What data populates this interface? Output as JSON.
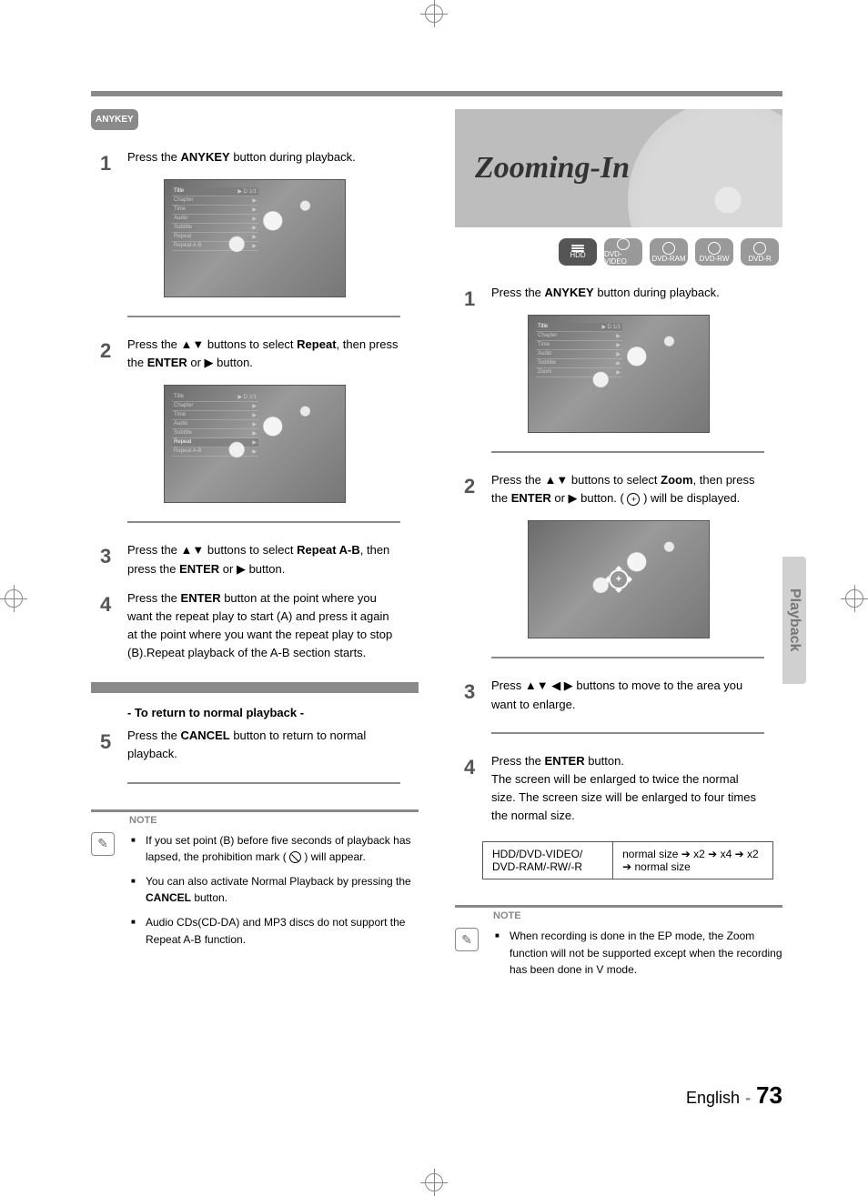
{
  "left": {
    "badge": "ANYKEY",
    "step1": {
      "num": "1",
      "pre": "Press the ",
      "btn": "ANYKEY",
      "post": " button during playback."
    },
    "step2": {
      "num": "2",
      "pre": "Press the ",
      "nav": "▲▼",
      "mid": " buttons to select ",
      "sel": "Repeat",
      "mid2": ", then press the ",
      "btn": "ENTER",
      "or": " or ",
      "arrow": "▶",
      "post": " button."
    },
    "step3": {
      "num": "3",
      "pre": "Press the ",
      "nav": "▲▼",
      "mid": " buttons to select ",
      "sel": "Repeat A-B",
      "mid2": ", then press the ",
      "btn": "ENTER",
      "or": " or ",
      "arrow": "▶",
      "post": " button."
    },
    "step4": {
      "num": "4",
      "pre": "Press the ",
      "btn": "ENTER",
      "post": " button at the point where you want the repeat play to start (A) and press it again at the point where you want the repeat play to stop (B).Repeat playback of the A-B section starts."
    },
    "cancel_heading": "- To return to normal playback -",
    "step5": {
      "num": "5",
      "pre": "Press the ",
      "btn": "CANCEL",
      "post": " button to return to normal playback."
    },
    "note_tag": "NOTE",
    "notes": [
      {
        "pre": "If you set point (B) before five seconds of playback has lapsed, the prohibition mark ( ",
        "post": " ) will appear."
      },
      {
        "pre": "You can also activate Normal Playback by pressing the ",
        "btn": "CANCEL",
        "post": " button."
      },
      {
        "txt": "Audio CDs(CD-DA) and MP3 discs do not support the Repeat A-B function."
      }
    ],
    "menu": {
      "rows": [
        {
          "l": "Title",
          "r": "D 1/1"
        },
        {
          "l": "Chapter",
          "r": ""
        },
        {
          "l": "Time",
          "r": ""
        },
        {
          "l": "Audio",
          "r": ""
        },
        {
          "l": "Subtitle",
          "r": ""
        },
        {
          "l": "Repeat",
          "r": ""
        },
        {
          "l": "Repeat A-B",
          "r": ""
        }
      ]
    }
  },
  "right": {
    "title": "Zooming-In",
    "media": [
      "HDD",
      "DVD-VIDEO",
      "DVD-RAM",
      "DVD-RW",
      "DVD-R"
    ],
    "step1": {
      "num": "1",
      "pre": "Press the ",
      "btn": "ANYKEY",
      "post": " button during playback."
    },
    "step2": {
      "num": "2",
      "pre": "Press the ",
      "nav": "▲▼",
      "mid": " buttons to select ",
      "sel": "Zoom",
      "mid2": ", then press the ",
      "btn": "ENTER",
      "or": " or ",
      "arrow": "▶",
      "post": " button. ( ",
      "post2": " ) will be displayed."
    },
    "step3": {
      "num": "3",
      "pre": "Press ",
      "nav": "▲▼ ◀ ▶",
      "post": " buttons to move to the area you want to enlarge."
    },
    "step4": {
      "num": "4",
      "pre": "Press the ",
      "btn": "ENTER",
      "post": " button.",
      "line2": "The screen will be enlarged to twice the normal size. The screen size will be enlarged to four times the normal size."
    },
    "zoom_table": {
      "c1": "HDD/DVD-VIDEO/\nDVD-RAM/-RW/-R",
      "c2": "normal size ➔ x2 ➔ x4 ➔ x2 ➔ normal size"
    },
    "note_tag": "NOTE",
    "notes": [
      {
        "txt": "When recording is done in the EP mode, the Zoom function will not be supported except when the recording has been done in V mode."
      }
    ],
    "menu": {
      "rows": [
        {
          "l": "Title",
          "r": "D 1/1"
        },
        {
          "l": "Chapter",
          "r": ""
        },
        {
          "l": "Time",
          "r": ""
        },
        {
          "l": "Audio",
          "r": ""
        },
        {
          "l": "Subtitle",
          "r": ""
        },
        {
          "l": "Zoom",
          "r": ""
        }
      ]
    }
  },
  "side_tab": "Playback",
  "footer": {
    "lang": "English",
    "dash": "-",
    "page": "73"
  }
}
